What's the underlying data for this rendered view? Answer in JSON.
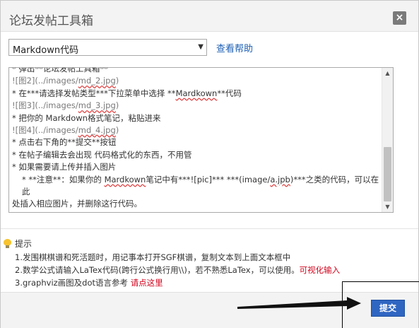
{
  "dialog": {
    "title": "论坛发帖工具箱",
    "close_label": "×"
  },
  "type_select": {
    "value": "Markdown代码",
    "caret": "▼"
  },
  "help_link": "查看帮助",
  "editor": {
    "lines": [
      {
        "parts": [
          {
            "t": "* 弹出**论坛发帖工具箱**"
          }
        ]
      },
      {
        "parts": [
          {
            "t": "![图2](../images/"
          },
          {
            "t": "md_2.jpg",
            "sq": true
          },
          {
            "t": ")"
          }
        ],
        "md": true
      },
      {
        "parts": [
          {
            "t": "* 在***请选择发帖类型***下拉菜单中选择 **"
          },
          {
            "t": "Mardkown",
            "sq": true
          },
          {
            "t": "**代码"
          }
        ]
      },
      {
        "parts": [
          {
            "t": "![图3](../images/"
          },
          {
            "t": "md_3.jpg",
            "sq": true
          },
          {
            "t": ")"
          }
        ],
        "md": true
      },
      {
        "parts": [
          {
            "t": "* 把你的 Markdown格式笔记，粘贴进来"
          }
        ]
      },
      {
        "parts": [
          {
            "t": "![图4](../images/"
          },
          {
            "t": "md_4.jpg",
            "sq": true
          },
          {
            "t": ")"
          }
        ],
        "md": true
      },
      {
        "parts": [
          {
            "t": "* 点击右下角的**提交**按钮"
          }
        ]
      },
      {
        "parts": [
          {
            "t": "* 在帖子编辑去会出现 代码格式化的东西，不用管"
          }
        ]
      },
      {
        "parts": [
          {
            "t": "* 如果需要请上传并插入图片"
          }
        ]
      },
      {
        "parts": [
          {
            "t": "* **注意**：如果你的 "
          },
          {
            "t": "Mardkown",
            "sq": true
          },
          {
            "t": "笔记中有***![pic]*** ***(image/"
          },
          {
            "t": "a.jpb",
            "sq": true
          },
          {
            "t": ")***之类的代码，可以在此"
          }
        ],
        "note": true
      },
      {
        "parts": [
          {
            "t": "处插入相应图片，并删除这行代码。"
          }
        ]
      }
    ]
  },
  "tips": {
    "title": "提示",
    "items": [
      {
        "text": "1.发围棋棋谱和死活题时，用记事本打开SGF棋谱，复制文本到上面文本框中",
        "link": ""
      },
      {
        "text": "2.数学公式请输入LaTex代码(跨行公式换行用\\\\)，若不熟悉LaTex，可以使用。",
        "link": "可视化输入"
      },
      {
        "text": "3.graphviz画图及dot语言参考 ",
        "link": "请点这里"
      }
    ]
  },
  "submit_label": "提交",
  "colors": {
    "accent_button": "#2f66c2",
    "link_blue": "#1e5fb3",
    "link_red": "#d0021b"
  }
}
